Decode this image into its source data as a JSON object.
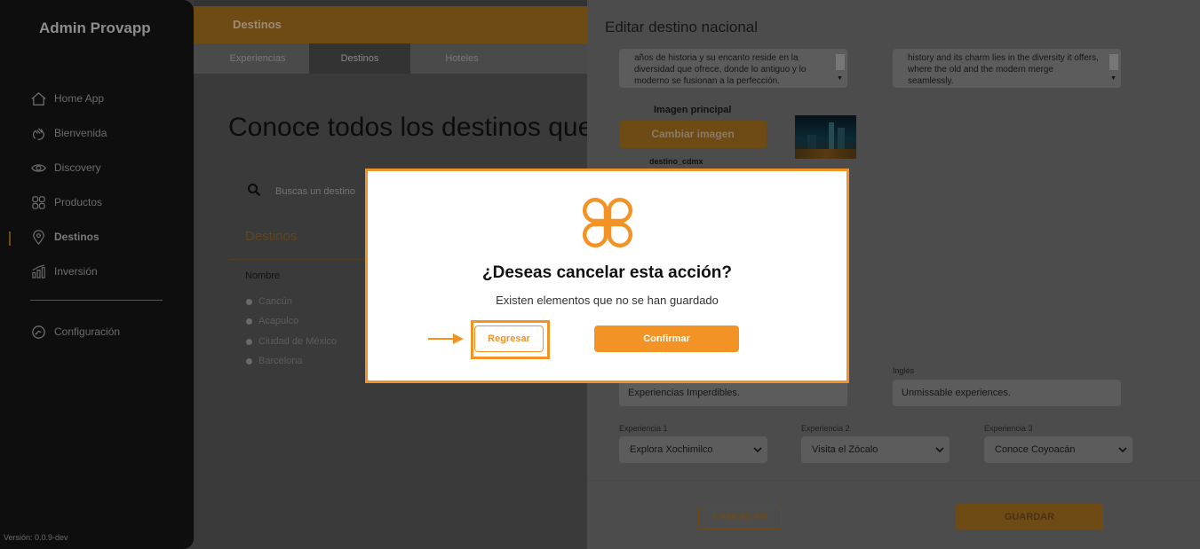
{
  "sidebar": {
    "brand": "Admin Provapp",
    "items": [
      {
        "label": "Home App",
        "icon": "home-icon"
      },
      {
        "label": "Bienvenida",
        "icon": "hand-wave-icon"
      },
      {
        "label": "Discovery",
        "icon": "eye-icon"
      },
      {
        "label": "Productos",
        "icon": "grid-icon"
      },
      {
        "label": "Destinos",
        "icon": "map-pin-icon",
        "active": true
      },
      {
        "label": "Inversión",
        "icon": "chart-icon"
      },
      {
        "label": "Configuración",
        "icon": "gear-icon"
      }
    ],
    "version": "Versión: 0.0.9-dev"
  },
  "header": {
    "title": "Destinos"
  },
  "tabs": [
    {
      "label": "Experiencias"
    },
    {
      "label": "Destinos",
      "active": true
    },
    {
      "label": "Hoteles"
    }
  ],
  "main": {
    "title": "Conoce todos los destinos que",
    "search_placeholder": "Buscas un destino",
    "section_title": "Destinos",
    "column_name": "Nombre",
    "destinations": [
      "Cancún",
      "Acapulco",
      "Ciudad de México",
      "Barcelona"
    ]
  },
  "panel": {
    "title": "Editar destino nacional",
    "description_es": "años de historia y su encanto reside en la diversidad que ofrece, donde lo antiguo y lo moderno se fusionan a la perfección.",
    "description_en": "history and its charm lies in the diversity it offers, where the old and the modern merge seamlessly.",
    "image_label": "Imagen principal",
    "change_image": "Cambiar imagen",
    "file_name": "destino_cdmx",
    "english_label": "Inglés",
    "subtitle_es": "Experiencias Imperdibles.",
    "subtitle_en": "Unmissable experiences.",
    "experiences": [
      {
        "label": "Experiencia 1",
        "value": "Explora Xochimilco"
      },
      {
        "label": "Experiencia 2",
        "value": "Visita el Zócalo"
      },
      {
        "label": "Experiencia 3",
        "value": "Conoce Coyoacán"
      }
    ],
    "cancel": "CANCELAR",
    "save": "GUARDAR"
  },
  "modal": {
    "title": "¿Deseas cancelar esta acción?",
    "subtitle": "Existen elementos que no se han guardado",
    "back": "Regresar",
    "confirm": "Confirmar",
    "icon": "clover-logo-icon"
  },
  "colors": {
    "accent": "#f39325",
    "accent_dimmed": "#6e4a14",
    "overlay_bg": "#3a3a3a"
  }
}
